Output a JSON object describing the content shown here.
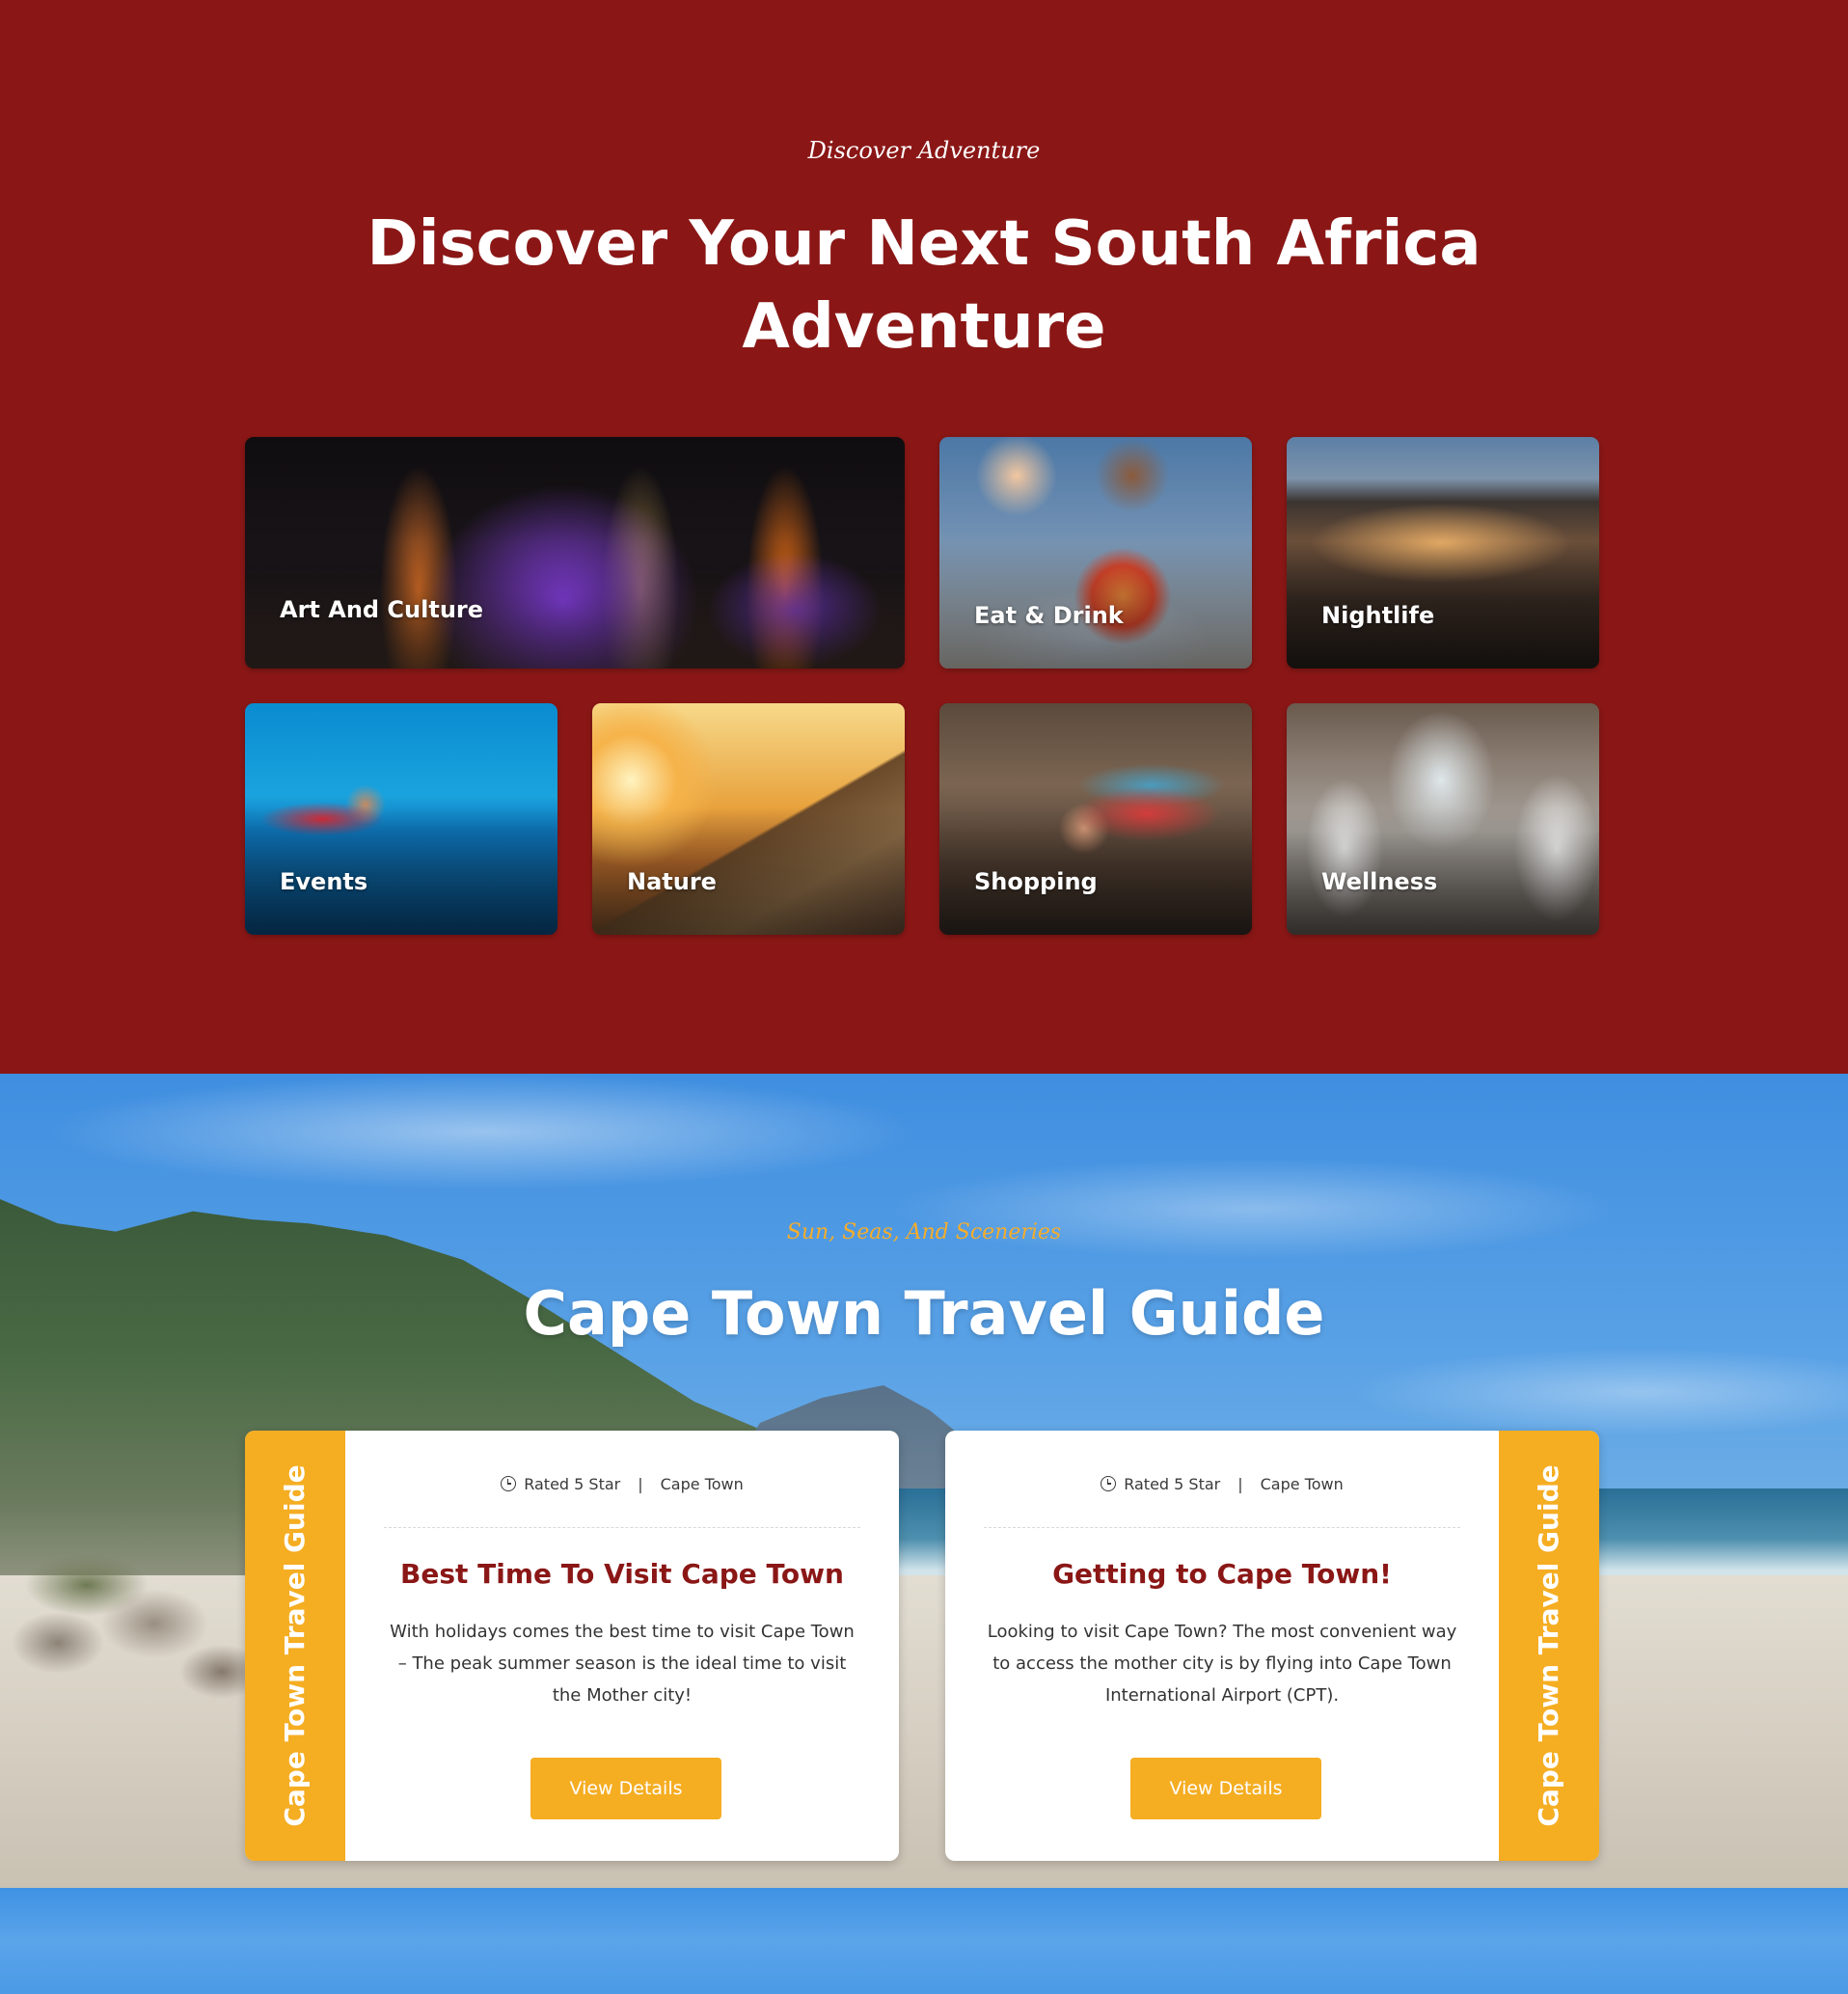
{
  "discover": {
    "kicker": "Discover Adventure",
    "title": "Discover Your Next South Africa Adventure",
    "categories": [
      {
        "label": "Art And Culture"
      },
      {
        "label": "Eat & Drink"
      },
      {
        "label": "Nightlife"
      },
      {
        "label": "Events"
      },
      {
        "label": "Nature"
      },
      {
        "label": "Shopping"
      },
      {
        "label": "Wellness"
      }
    ]
  },
  "guide": {
    "kicker": "Sun, Seas, And Sceneries",
    "title": "Cape Town Travel Guide",
    "cards": [
      {
        "strip_label": "Cape Town Travel Guide",
        "rating": "Rated 5 Star",
        "separator": "|",
        "location": "Cape Town",
        "title": "Best Time To Visit Cape Town",
        "description": "With holidays comes the best time to visit Cape Town – The peak summer season is the ideal time to visit the Mother city!",
        "button_label": "View Details"
      },
      {
        "strip_label": "Cape Town Travel Guide",
        "rating": "Rated 5 Star",
        "separator": "|",
        "location": "Cape Town",
        "title": "Getting to Cape Town!",
        "description": "Looking to visit Cape Town? The most convenient way to access the mother city is by flying into Cape Town International Airport (CPT).",
        "button_label": "View Details"
      }
    ]
  },
  "colors": {
    "brand_red": "#8a1716",
    "accent_yellow": "#f5ad22",
    "white": "#ffffff"
  },
  "icons": {
    "meta_icon": "clock-icon"
  }
}
